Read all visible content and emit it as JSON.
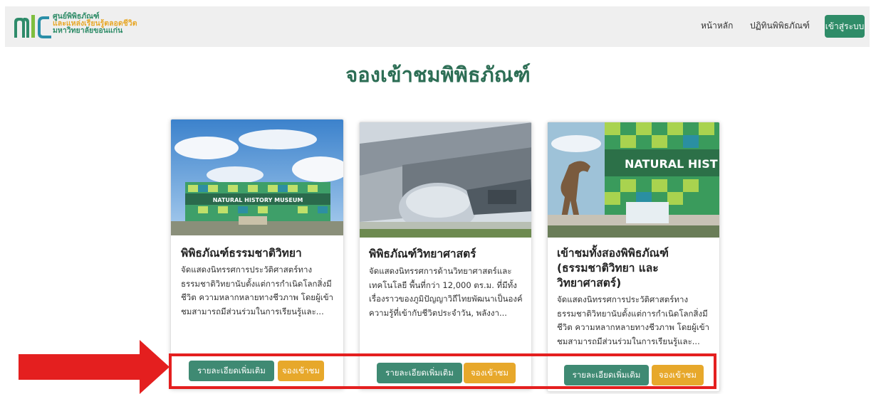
{
  "header": {
    "logo_line1": "ศูนย์พิพิธภัณฑ์",
    "logo_line2": "และแหล่งเรียนรู้ตลอดชีวิต",
    "logo_line3": "มหาวิทยาลัยขอนแก่น",
    "nav_home": "หน้าหลัก",
    "nav_calendar": "ปฏิทินพิพิธภัณฑ์",
    "login": "เข้าสู่ระบบ"
  },
  "page_title": "จองเข้าชมพิพิธภัณฑ์",
  "cards": [
    {
      "title": "พิพิธภัณฑ์ธรรมชาติวิทยา",
      "image_text": "NATURAL HISTORY MUSEUM",
      "description": "จัดแสดงนิทรรศการประวัติศาสตร์ทางธรรมชาติวิทยานับตั้งแต่การกำเนิดโลกสิ่งมีชีวิต ความหลากหลายทางชีวภาพ โดยผู้เข้าชมสามารถมีส่วนร่วมในการเรียนรู้และ...",
      "detail_label": "รายละเอียดเพิ่มเติม",
      "book_label": "จองเข้าชม"
    },
    {
      "title": "พิพิธภัณฑ์วิทยาศาสตร์",
      "description": "จัดแสดงนิทรรศการด้านวิทยาศาสตร์และเทคโนโลยี พื้นที่กว่า 12,000 ตร.ม. ที่มีทั้งเรื่องราวของภูมิปัญญาวิถีไทยพัฒนาเป็นองค์ความรู้ที่เข้ากับชีวิตประจำวัน, พลังงา...",
      "detail_label": "รายละเอียดเพิ่มเติม",
      "book_label": "จองเข้าชม"
    },
    {
      "title": "เข้าชมทั้งสองพิพิธภัณฑ์ (ธรรมชาติวิทยา และวิทยาศาสตร์)",
      "image_text": "NATURAL HIST",
      "description": "จัดแสดงนิทรรศการประวัติศาสตร์ทางธรรมชาติวิทยานับตั้งแต่การกำเนิดโลกสิ่งมีชีวิต ความหลากหลายทางชีวภาพ โดยผู้เข้าชมสามารถมีส่วนร่วมในการเรียนรู้และ...",
      "detail_label": "รายละเอียดเพิ่มเติม",
      "book_label": "จองเข้าชม"
    }
  ],
  "colors": {
    "brand_green": "#2f8c68",
    "title_green": "#2d6e55",
    "detail_button": "#3f8a73",
    "book_button": "#e7a82b",
    "annotation_red": "#e41f1f"
  },
  "annotations": {
    "icons": [
      "logo-icon",
      "red-arrow-icon"
    ]
  }
}
